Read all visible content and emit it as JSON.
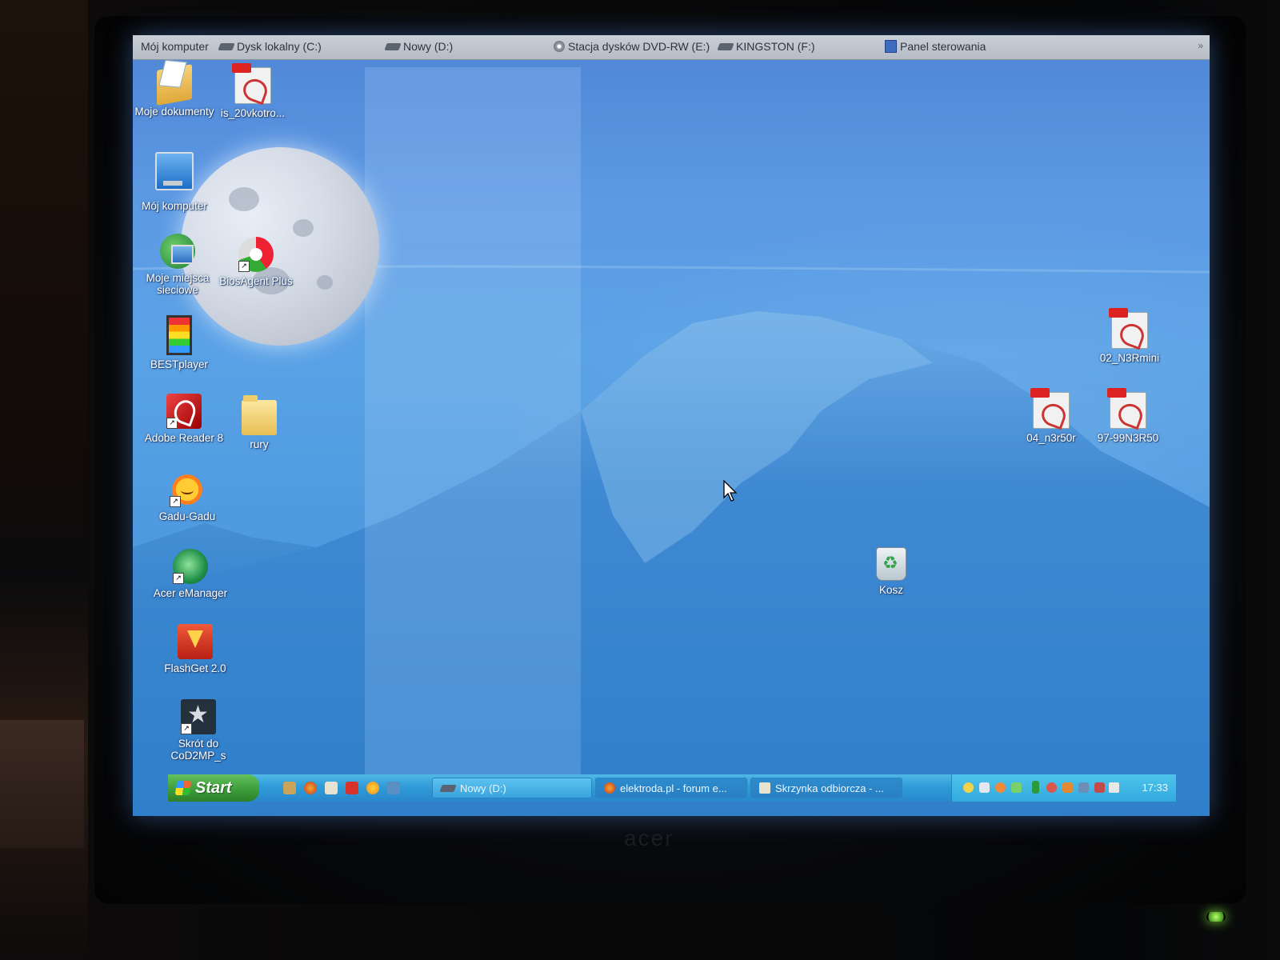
{
  "toolbar": {
    "items": [
      {
        "label": "Mój komputer",
        "icon": "computer-icon"
      },
      {
        "label": "Dysk lokalny (C:)",
        "icon": "drive-icon"
      },
      {
        "label": "Nowy (D:)",
        "icon": "drive-icon"
      },
      {
        "label": "Stacja dysków DVD-RW (E:)",
        "icon": "dvd-drive-icon"
      },
      {
        "label": "KINGSTON (F:)",
        "icon": "drive-icon"
      },
      {
        "label": "Panel sterowania",
        "icon": "control-panel-icon"
      }
    ]
  },
  "desktop": {
    "icons": [
      {
        "label": "Moje dokumenty",
        "icon": "my-documents-icon"
      },
      {
        "label": "is_20vkotro...",
        "icon": "pdf-file-icon"
      },
      {
        "label": "Mój komputer",
        "icon": "my-computer-icon"
      },
      {
        "label": "Moje miejsca sieciowe",
        "icon": "network-places-icon"
      },
      {
        "label": "BiosAgent Plus",
        "icon": "biosagent-icon"
      },
      {
        "label": "BESTplayer",
        "icon": "film-strip-icon"
      },
      {
        "label": "Adobe Reader 8",
        "icon": "adobe-reader-icon"
      },
      {
        "label": "rury",
        "icon": "folder-icon"
      },
      {
        "label": "Gadu-Gadu",
        "icon": "gadu-gadu-icon"
      },
      {
        "label": "Acer eManager",
        "icon": "acer-emanager-icon"
      },
      {
        "label": "FlashGet 2.0",
        "icon": "flashget-icon"
      },
      {
        "label": "Skrót do CoD2MP_s",
        "icon": "cod2-icon"
      },
      {
        "label": "02_N3Rmini",
        "icon": "pdf-file-icon"
      },
      {
        "label": "04_n3r50r",
        "icon": "pdf-file-icon"
      },
      {
        "label": "97-99N3R50",
        "icon": "pdf-file-icon"
      },
      {
        "label": "Kosz",
        "icon": "recycle-bin-icon"
      }
    ]
  },
  "taskbar": {
    "start_label": "Start",
    "quick_launch": [
      "explorer-icon",
      "firefox-icon",
      "outlook-icon",
      "pdf-icon",
      "gadu-icon",
      "network-icon"
    ],
    "buttons": [
      {
        "label": "Nowy (D:)",
        "icon": "drive-icon",
        "active": false
      },
      {
        "label": "elektroda.pl - forum e...",
        "icon": "firefox-icon",
        "active": false
      },
      {
        "label": "Skrzynka odbiorcza - ...",
        "icon": "mail-icon",
        "active": false
      }
    ],
    "clock": "17:33"
  },
  "brand": {
    "logo_text": "acer"
  },
  "colors": {
    "taskbar": "#2f9bd8",
    "start_button": "#3a9a38",
    "desktop_sky": "#5aa2e6"
  }
}
